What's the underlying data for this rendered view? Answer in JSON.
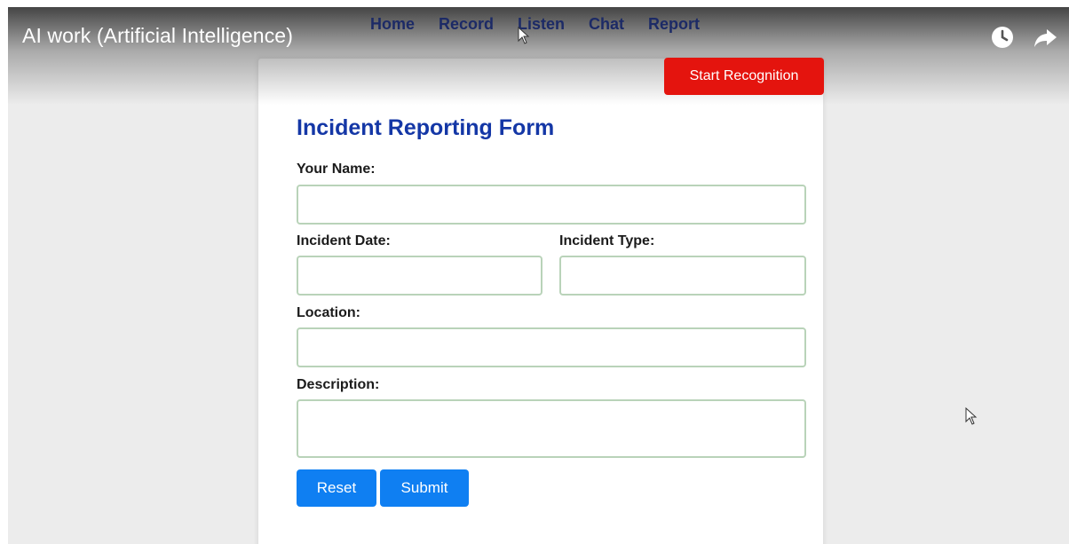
{
  "video": {
    "title": "AI work (Artificial Intelligence)",
    "icons": [
      "clock-icon",
      "share-icon"
    ]
  },
  "nav": {
    "items": [
      {
        "label": "Home"
      },
      {
        "label": "Record"
      },
      {
        "label": "Listen"
      },
      {
        "label": "Chat"
      },
      {
        "label": "Report"
      }
    ]
  },
  "recognition": {
    "start_label": "Start Recognition"
  },
  "form": {
    "title": "Incident Reporting Form",
    "name_label": "Your Name:",
    "name_value": "",
    "date_label": "Incident Date:",
    "date_value": "",
    "type_label": "Incident Type:",
    "type_value": "",
    "location_label": "Location:",
    "location_value": "",
    "description_label": "Description:",
    "description_value": "",
    "reset_label": "Reset",
    "submit_label": "Submit"
  },
  "colors": {
    "nav_text": "#1c2a66",
    "title": "#1437a6",
    "start_button": "#e4140e",
    "primary_button": "#0f7ff2",
    "field_border": "#b9d3b9"
  }
}
